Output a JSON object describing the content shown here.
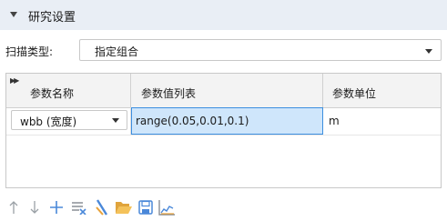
{
  "section": {
    "title": "研究设置"
  },
  "sweep": {
    "label": "扫描类型:",
    "selected": "指定组合"
  },
  "table": {
    "columns": [
      "参数名称",
      "参数值列表",
      "参数单位"
    ],
    "rows": [
      {
        "name": "wbb (宽度)",
        "values": "range(0.05,0.01,0.1)",
        "unit": "m"
      }
    ]
  },
  "toolbar": {
    "icons": [
      "move-up-icon",
      "move-down-icon",
      "add-icon",
      "clear-table-icon",
      "range-icon",
      "load-from-file-icon",
      "save-to-file-icon",
      "plot-icon"
    ]
  },
  "colors": {
    "accent": "#3d8fe0",
    "selected_cell_bg": "#cfe6fb",
    "header_bg": "#e9eef5"
  }
}
